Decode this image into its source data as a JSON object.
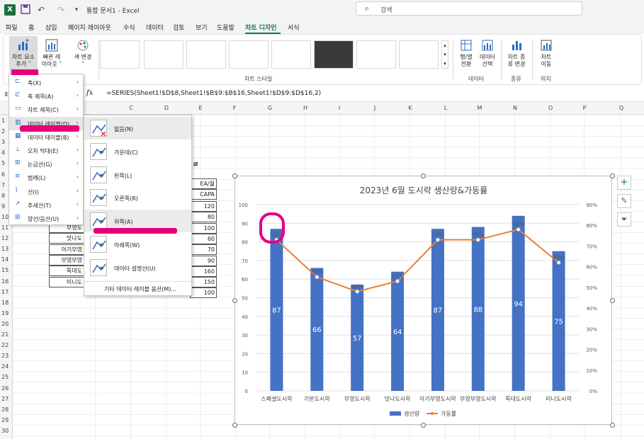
{
  "titlebar": {
    "doc_title": "통합 문서1  -  Excel",
    "search_placeholder": "검색",
    "qa_more": "▾"
  },
  "menu": [
    {
      "label": "파일",
      "active": false
    },
    {
      "label": "홈",
      "active": false
    },
    {
      "label": "삽입",
      "active": false
    },
    {
      "label": "페이지 레이아웃",
      "active": false
    },
    {
      "label": "수식",
      "active": false
    },
    {
      "label": "데이터",
      "active": false
    },
    {
      "label": "검토",
      "active": false
    },
    {
      "label": "보기",
      "active": false
    },
    {
      "label": "도움말",
      "active": false
    },
    {
      "label": "차트 디자인",
      "active": true
    },
    {
      "label": "서식",
      "active": false
    }
  ],
  "ribbon": {
    "add_element": "차트 요소\n추가 ˅",
    "quick_layout": "빠른 레\n이아웃 ˅",
    "change_color": "색 변경\n˅",
    "chart_styles_label": "차트 스타일",
    "switch_rowcol": "행/열\n전환",
    "select_data": "데이터\n선택",
    "data_group": "데이터",
    "change_type": "차트 종\n류 변경",
    "type_group": "종류",
    "move_chart": "차트\n이동",
    "location_group": "위치"
  },
  "formula": {
    "name_box": "차",
    "fx": "fx",
    "text": "=SERIES(Sheet1!$D$8,Sheet1!$B$9:$B$16,Sheet1!$D$9:$D$16,2)"
  },
  "columns": [
    "C",
    "D",
    "E",
    "F",
    "G",
    "H",
    "I",
    "J",
    "K",
    "L",
    "M",
    "N",
    "O",
    "P",
    "Q"
  ],
  "rows": [
    "1",
    "2",
    "3",
    "4",
    "5",
    "6",
    "7",
    "8",
    "9",
    "10",
    "11",
    "12",
    "13",
    "14",
    "15",
    "16",
    "17",
    "18",
    "19",
    "20",
    "21",
    "22",
    "23",
    "24",
    "25",
    "26",
    "27",
    "28",
    "29",
    "30"
  ],
  "sheet_text": {
    "hidden_label": "ㄹ",
    "col_e_header": "EA/월",
    "col_e_sub": "CAPA",
    "capa_values": [
      "120",
      "80",
      "100",
      "60",
      "70",
      "90",
      "160",
      "150",
      "100"
    ],
    "row_names": [
      "부영도",
      "맛나도",
      "아기부영",
      "부영부영",
      "특대도",
      "미니도"
    ]
  },
  "menu1_items": [
    {
      "icon": "axis",
      "label": "축(X)",
      "arrow": "›"
    },
    {
      "icon": "axis-title",
      "label": "축 제목(A)",
      "arrow": "›"
    },
    {
      "icon": "chart-title",
      "label": "차트 제목(C)",
      "arrow": "›"
    },
    {
      "icon": "data-labels",
      "label": "데이터 레이블(D)",
      "arrow": "›"
    },
    {
      "icon": "data-table",
      "label": "데이터 테이블(B)",
      "arrow": "›"
    },
    {
      "icon": "error-bars",
      "label": "오차 막대(E)",
      "arrow": "›"
    },
    {
      "icon": "gridlines",
      "label": "눈금선(G)",
      "arrow": "›"
    },
    {
      "icon": "legend",
      "label": "범례(L)",
      "arrow": "›"
    },
    {
      "icon": "lines",
      "label": "선(I)",
      "arrow": "›"
    },
    {
      "icon": "trendline",
      "label": "추세선(T)",
      "arrow": "›"
    },
    {
      "icon": "updown-bars",
      "label": "양선/음선(U)",
      "arrow": "›"
    }
  ],
  "menu2_items": [
    {
      "label": "없음(N)"
    },
    {
      "label": "가운데(C)"
    },
    {
      "label": "왼쪽(L)"
    },
    {
      "label": "오른쪽(R)"
    },
    {
      "label": "위쪽(A)"
    },
    {
      "label": "아래쪽(W)"
    },
    {
      "label": "데이터 설명선(U)"
    }
  ],
  "menu2_more": "기타 데이터 레이블 옵션(M)...",
  "accent": "#107c41",
  "highlight_color": "#e6007e",
  "chart_data": {
    "type": "bar",
    "title": "2023년 6월 도시락 생산량&가동률",
    "categories": [
      "스페셜도시락",
      "기본도시락",
      "부영도시락",
      "맛나도시락",
      "아기부영도시락",
      "부영부영도시락",
      "특대도시락",
      "미니도시락"
    ],
    "series": [
      {
        "name": "생산량",
        "type": "bar",
        "axis": "left",
        "values": [
          87,
          66,
          57,
          64,
          87,
          88,
          94,
          75
        ],
        "color": "#4472c4"
      },
      {
        "name": "가동률",
        "type": "line",
        "axis": "right",
        "values": [
          73,
          55,
          48,
          53,
          73,
          73,
          78,
          62
        ],
        "labels": [
          "73%",
          "55%",
          "48%",
          "53%",
          "73%",
          "73%",
          "78%",
          "63%"
        ],
        "color": "#ed7d31"
      }
    ],
    "y_left": {
      "min": 0,
      "max": 100,
      "ticks": [
        0,
        10,
        20,
        30,
        40,
        50,
        60,
        70,
        80,
        90,
        100
      ]
    },
    "y_right": {
      "min": 0,
      "max": 90,
      "ticks": [
        "0%",
        "10%",
        "20%",
        "30%",
        "40%",
        "50%",
        "60%",
        "70%",
        "80%",
        "90%"
      ]
    },
    "legend": {
      "position": "bottom"
    },
    "grid": true
  }
}
